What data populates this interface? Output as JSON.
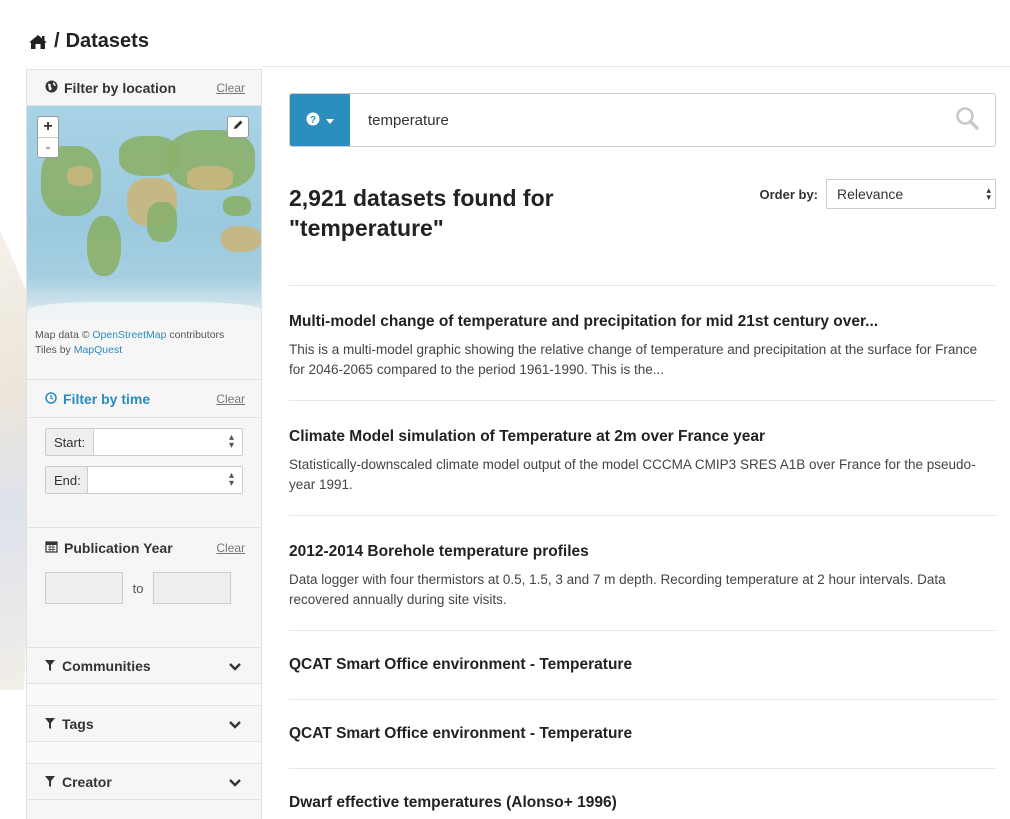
{
  "breadcrumb": {
    "icon": "home-icon",
    "separator": "/",
    "label": "Datasets"
  },
  "sidebar": {
    "location": {
      "title": "Filter by location",
      "clear": "Clear",
      "zoom_in": "+",
      "zoom_out": "-"
    },
    "attribution": {
      "line1_prefix": "Map data © ",
      "line1_link": "OpenStreetMap",
      "line1_suffix": " contributors",
      "line2_prefix": "Tiles by ",
      "line2_link": "MapQuest"
    },
    "time": {
      "title": "Filter by time",
      "clear": "Clear",
      "start_label": "Start:",
      "end_label": "End:"
    },
    "pub_year": {
      "title": "Publication Year",
      "clear": "Clear",
      "to": "to"
    },
    "facets": [
      {
        "title": "Communities"
      },
      {
        "title": "Tags"
      },
      {
        "title": "Creator"
      }
    ]
  },
  "search": {
    "value": "temperature",
    "type_icon": "question-icon"
  },
  "results": {
    "count_text": "2,921 datasets found for \"temperature\"",
    "order_label": "Order by:",
    "order_value": "Relevance",
    "items": [
      {
        "title": "Multi-model change of temperature and precipitation for mid 21st century over...",
        "desc": "This is a multi-model graphic showing the relative change of temperature and precipitation at the surface for France for 2046-2065 compared to the period 1961-1990. This is the..."
      },
      {
        "title": "Climate Model simulation of Temperature at 2m over France year",
        "desc": "Statistically-downscaled climate model output of the model CCCMA CMIP3 SRES A1B over France for the pseudo-year 1991."
      },
      {
        "title": "2012-2014 Borehole temperature profiles",
        "desc": "Data logger with four thermistors at 0.5, 1.5, 3 and 7 m depth. Recording temperature at 2 hour intervals. Data recovered annually during site visits."
      },
      {
        "title": "QCAT Smart Office environment - Temperature",
        "desc": ""
      },
      {
        "title": "QCAT Smart Office environment - Temperature",
        "desc": ""
      },
      {
        "title": "Dwarf effective temperatures (Alonso+ 1996)",
        "desc": ""
      }
    ]
  }
}
